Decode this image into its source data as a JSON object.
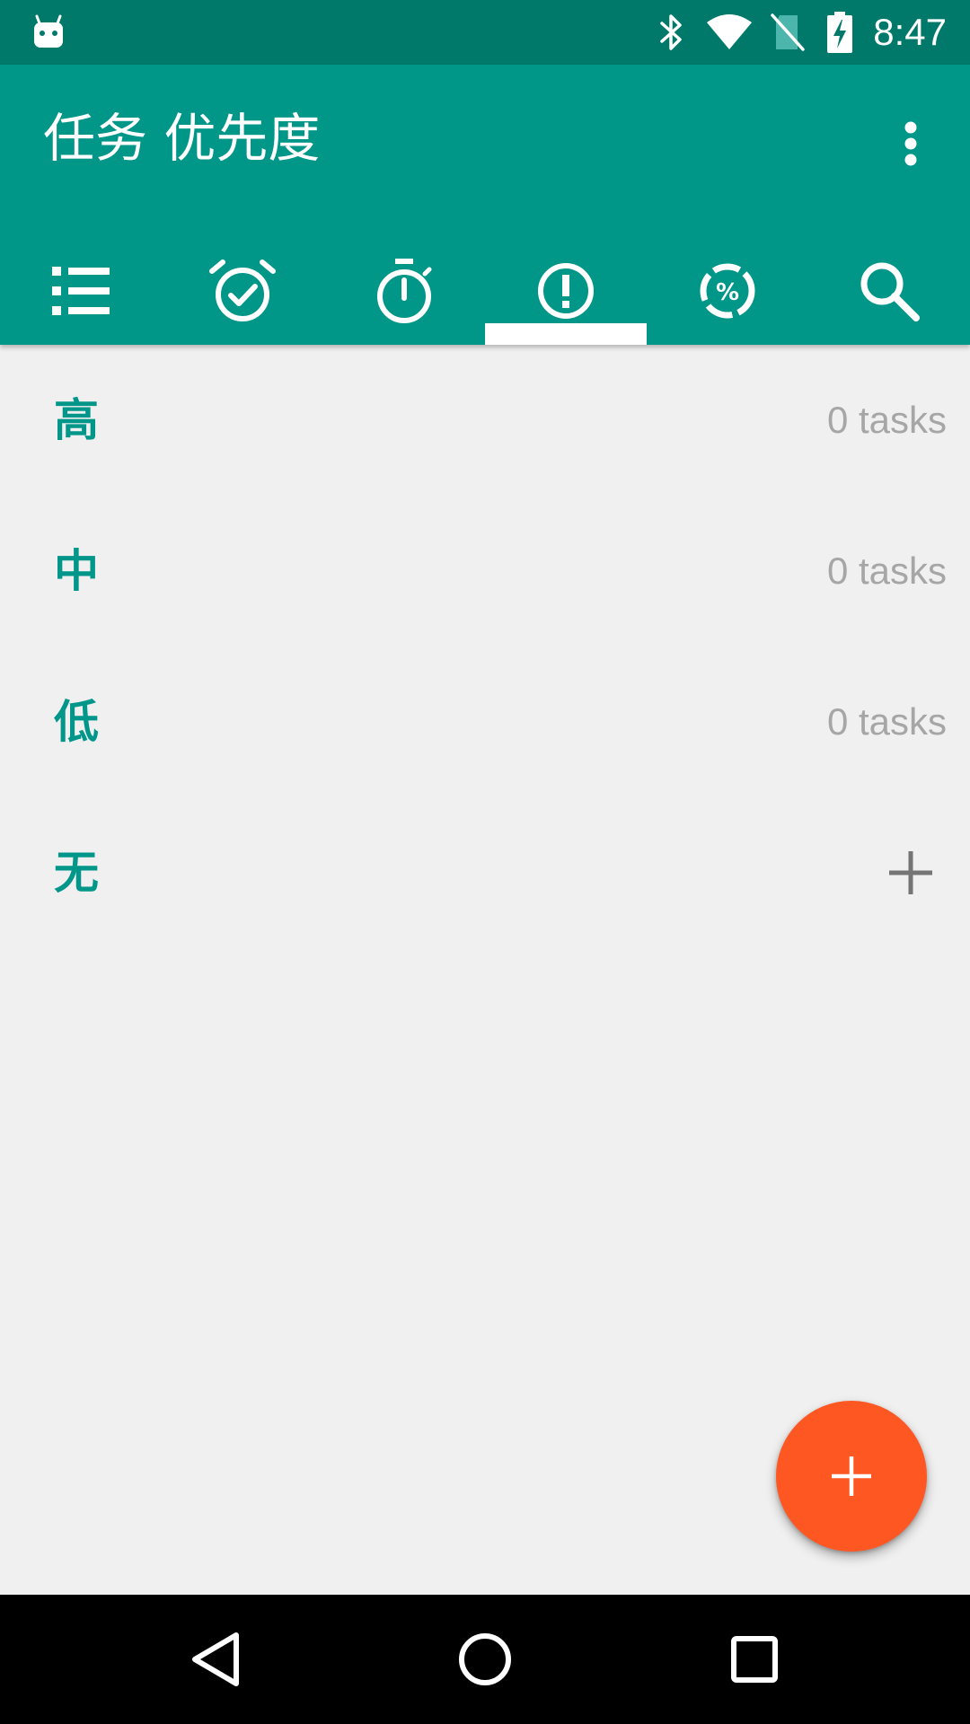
{
  "status_bar": {
    "time": "8:47",
    "icons": [
      "android-notification-icon",
      "bluetooth-icon",
      "wifi-icon",
      "no-sim-icon",
      "battery-charging-icon"
    ]
  },
  "app_bar": {
    "title": "任务 优先度",
    "overflow_icon": "more-vert-icon",
    "tabs": [
      {
        "icon": "list-icon",
        "selected": false
      },
      {
        "icon": "alarm-check-icon",
        "selected": false
      },
      {
        "icon": "timer-icon",
        "selected": false
      },
      {
        "icon": "priority-icon",
        "selected": true
      },
      {
        "icon": "progress-percent-icon",
        "selected": false
      },
      {
        "icon": "search-icon",
        "selected": false
      }
    ]
  },
  "priority_groups": [
    {
      "label": "高",
      "count": "0 tasks"
    },
    {
      "label": "中",
      "count": "0 tasks"
    },
    {
      "label": "低",
      "count": "0 tasks"
    },
    {
      "label": "无",
      "count": null,
      "action_icon": "add-icon"
    }
  ],
  "fab": {
    "icon": "add-icon"
  },
  "nav_bar": {
    "buttons": [
      "back-icon",
      "home-icon",
      "recents-icon"
    ]
  },
  "colors": {
    "status_bar": "#00796b",
    "primary": "#009688",
    "accent": "#ff5722",
    "label_text": "#00968a",
    "count_text": "#a6a6a6",
    "background": "#f0f0f0"
  }
}
